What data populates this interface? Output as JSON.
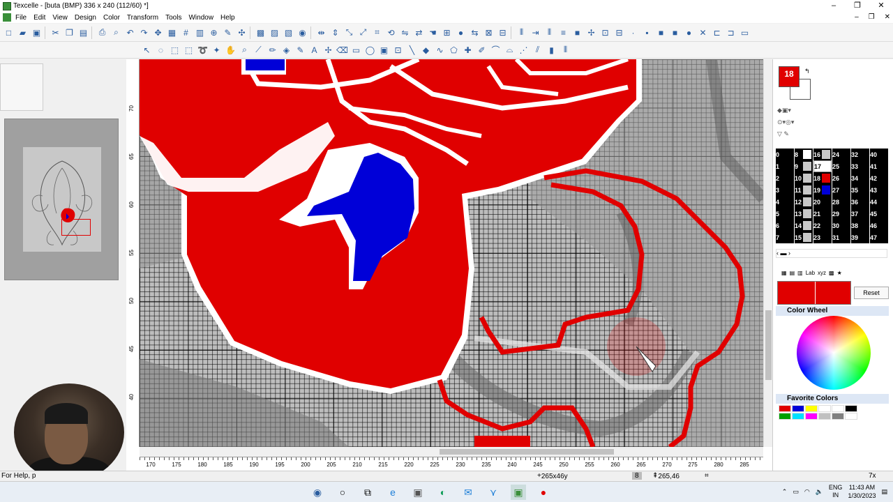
{
  "window": {
    "title": "Texcelle - [buta (BMP) 336 x 240 (112/60) *]",
    "minimize": "–",
    "maximize": "❐",
    "close": "✕"
  },
  "menu": [
    "File",
    "Edit",
    "View",
    "Design",
    "Color",
    "Transform",
    "Tools",
    "Window",
    "Help"
  ],
  "vruler_labels": [
    "70",
    "65",
    "60",
    "55",
    "50",
    "45",
    "40"
  ],
  "hruler_labels": [
    "170",
    "175",
    "180",
    "185",
    "190",
    "195",
    "200",
    "205",
    "210",
    "215",
    "220",
    "225",
    "230",
    "235",
    "240",
    "245",
    "250",
    "255",
    "260",
    "265",
    "270",
    "275",
    "280",
    "285"
  ],
  "colors": {
    "red": "#e00000",
    "blue": "#0000d8",
    "white": "#ffffff",
    "grey_light": "#c8c8c8",
    "grey_mid": "#a0a0a0",
    "grey_dark": "#707070"
  },
  "right_panel": {
    "current_color": "18",
    "palette_numbers": [
      [
        "0",
        "8",
        "16",
        "24",
        "32",
        "40"
      ],
      [
        "1",
        "9",
        "17",
        "25",
        "33",
        "41"
      ],
      [
        "2",
        "10",
        "18",
        "26",
        "34",
        "42"
      ],
      [
        "3",
        "11",
        "19",
        "27",
        "35",
        "43"
      ],
      [
        "4",
        "12",
        "20",
        "28",
        "36",
        "44"
      ],
      [
        "5",
        "13",
        "21",
        "29",
        "37",
        "45"
      ],
      [
        "6",
        "14",
        "22",
        "30",
        "38",
        "46"
      ],
      [
        "7",
        "15",
        "23",
        "31",
        "39",
        "47"
      ]
    ],
    "reset_label": "Reset",
    "color_wheel_title": "Color Wheel",
    "favorite_colors_title": "Favorite Colors",
    "tab_lab": "Lab",
    "tab_xyz": "xyz",
    "favorite_swatches": [
      "#e00000",
      "#0000d8",
      "#ffff00",
      "#ffffff",
      "#ffffff",
      "#000000",
      "#00a000",
      "#00e0ff",
      "#ff00ff",
      "#c0c0c0",
      "#808080",
      "#ffffff"
    ]
  },
  "status": {
    "help": "For Help, p",
    "coords": "265x46y",
    "index": "8",
    "position": "265,46",
    "zoom": "7x"
  },
  "taskbar": {
    "lang_top": "ENG",
    "lang_bottom": "IN",
    "time": "11:43 AM",
    "date": "1/30/2023"
  }
}
